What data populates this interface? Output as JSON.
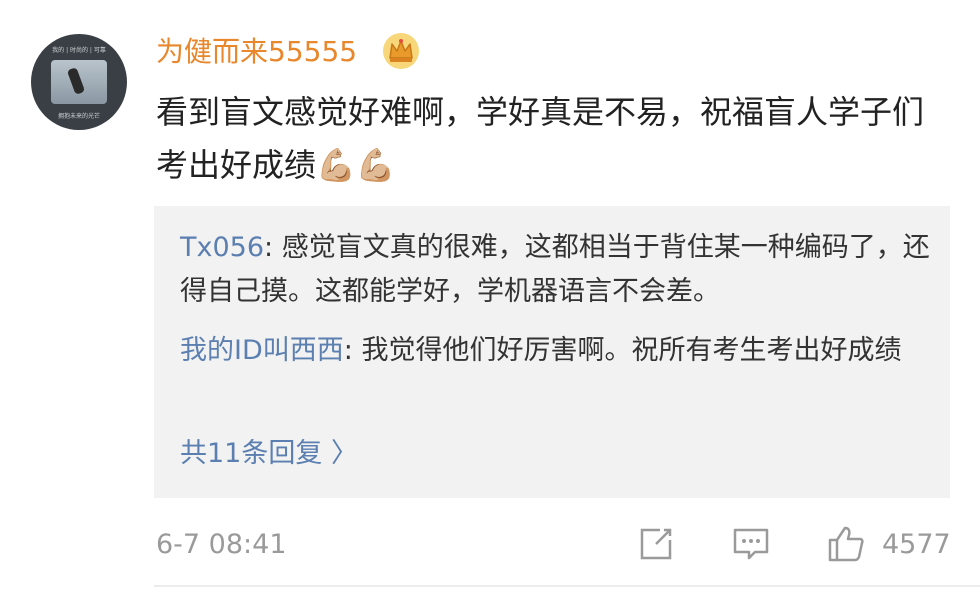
{
  "comment": {
    "username": "为健而来55555",
    "badge_icon": "crown-icon",
    "content": "看到盲文感觉好难啊，学好真是不易，祝福盲人学子们考出好成绩💪🏼💪🏼",
    "avatar": {
      "caption_top": "我的 | 时尚的 | 可靠",
      "caption_bottom": "拥抱未来的光芒"
    },
    "replies": [
      {
        "name": "Tx056",
        "text": ": 感觉盲文真的很难，这都相当于背住某一种编码了，还得自己摸。这都能学好，学机器语言不会差。"
      },
      {
        "name": "我的ID叫西西",
        "text": ": 我觉得他们好厉害啊。祝所有考生考出好成绩"
      }
    ],
    "more_replies": "共11条回复 〉",
    "timestamp": "6-7 08:41",
    "actions": {
      "share_icon": "share-icon",
      "comment_icon": "comment-icon",
      "like_icon": "thumbs-up-icon",
      "like_count": "4577"
    }
  },
  "colors": {
    "username": "#e8872b",
    "link": "#5b7fb0",
    "muted": "#9a9a9a",
    "reply_bg": "#f2f2f2"
  }
}
